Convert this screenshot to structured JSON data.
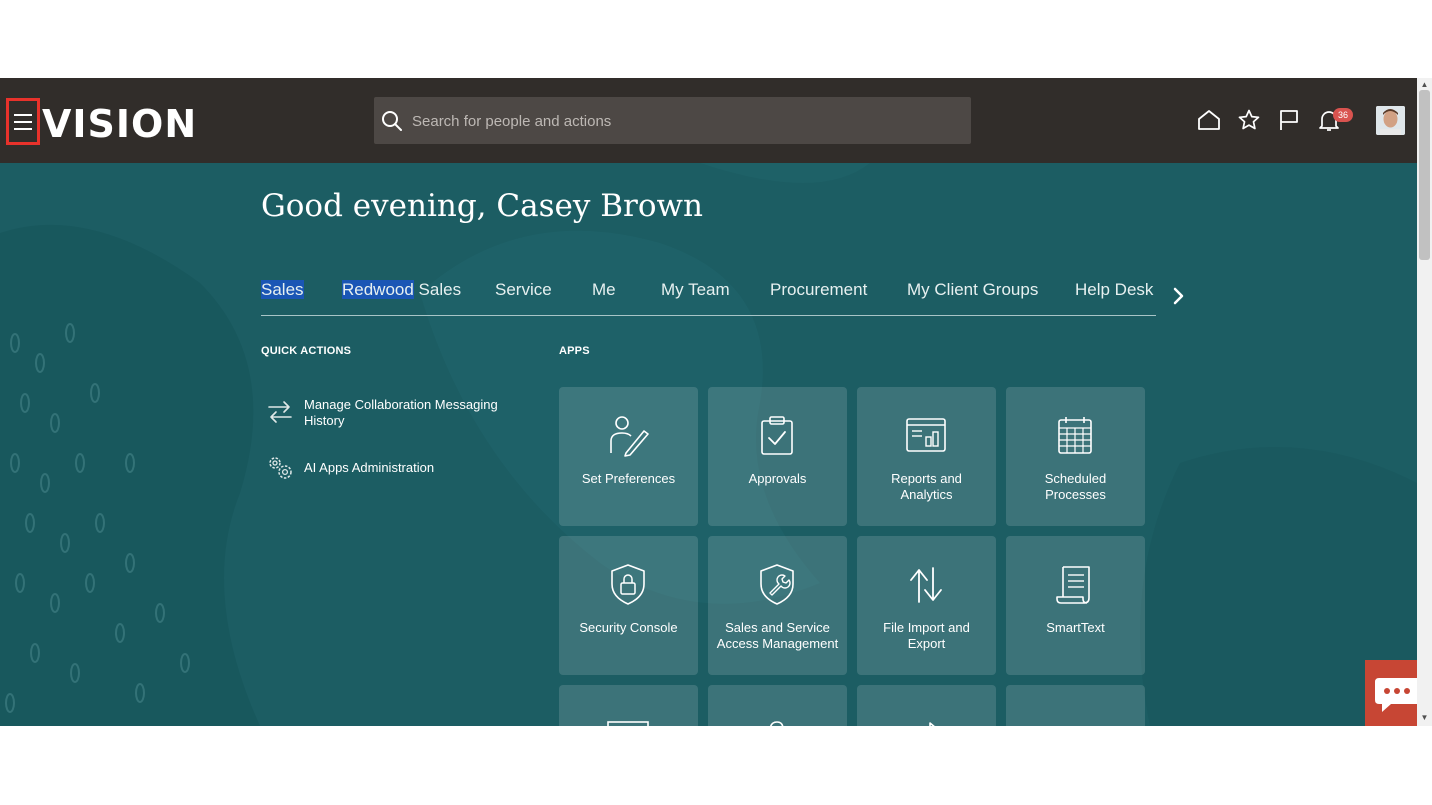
{
  "header": {
    "logo_text": "VISION",
    "search_placeholder": "Search for people and actions",
    "notification_count": "36",
    "icons": [
      "home-icon",
      "star-icon",
      "flag-icon",
      "bell-icon"
    ]
  },
  "greeting": "Good evening, Casey Brown",
  "tabs": [
    {
      "label": "Sales"
    },
    {
      "label_highlight": "Redwood",
      "label_rest": " Sales"
    },
    {
      "label": "Service"
    },
    {
      "label": "Me"
    },
    {
      "label": "My Team"
    },
    {
      "label": "Procurement"
    },
    {
      "label": "My Client Groups"
    },
    {
      "label": "Help Desk"
    }
  ],
  "quick_actions": {
    "title": "QUICK ACTIONS",
    "items": [
      {
        "label": "Manage Collaboration Messaging History",
        "icon": "transfer-arrows-icon"
      },
      {
        "label": "AI Apps Administration",
        "icon": "gears-icon"
      }
    ]
  },
  "apps": {
    "title": "APPS",
    "tiles": [
      {
        "label": "Set Preferences",
        "icon": "person-pencil-icon"
      },
      {
        "label": "Approvals",
        "icon": "clipboard-check-icon"
      },
      {
        "label": "Reports and Analytics",
        "icon": "report-chart-icon"
      },
      {
        "label": "Scheduled Processes",
        "icon": "calendar-grid-icon"
      },
      {
        "label": "Security Console",
        "icon": "shield-lock-icon"
      },
      {
        "label": "Sales and Service Access Management",
        "icon": "shield-wrench-icon"
      },
      {
        "label": "File Import and Export",
        "icon": "up-down-arrows-icon"
      },
      {
        "label": "SmartText",
        "icon": "scroll-document-icon"
      }
    ]
  },
  "colors": {
    "topbar": "#312d2a",
    "main_bg": "#1c5d63",
    "menu_highlight": "#e8322b",
    "badge": "#d9534f",
    "text_selection": "#1a56b5",
    "chat_button": "#c74634"
  }
}
